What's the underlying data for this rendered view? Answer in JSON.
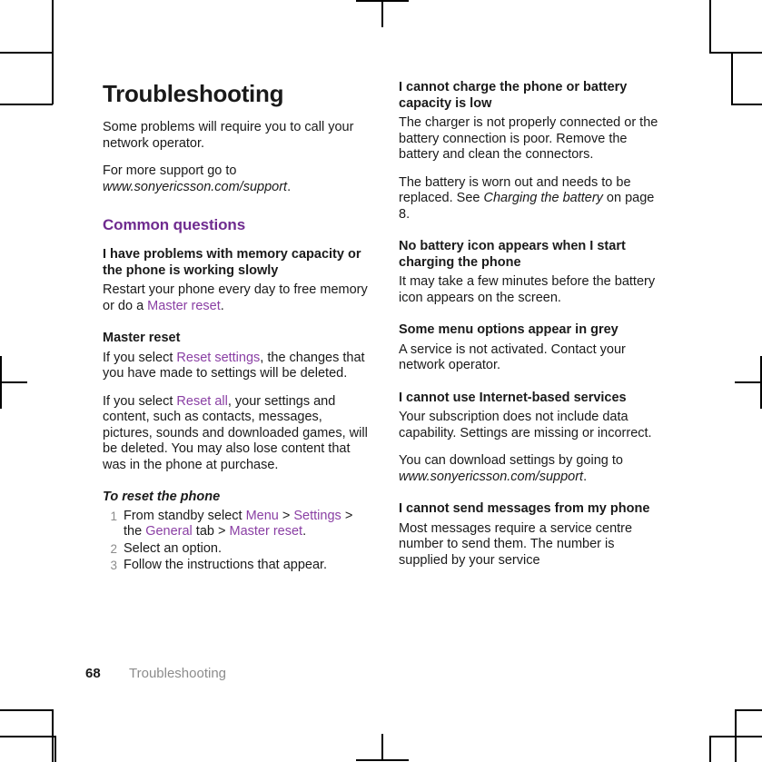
{
  "page": {
    "title": "Troubleshooting",
    "footer": {
      "page_number": "68",
      "label": "Troubleshooting"
    },
    "accent_color": "#6f2b8f",
    "link_color": "#8a3fa4",
    "step_number_color": "#8c8c8c",
    "footer_label_color": "#8c8c8c"
  },
  "left_column": {
    "intro_1": "Some problems will require you to call your network operator.",
    "intro_2_prefix": "For more support go to ",
    "intro_2_url": "www.sonyericsson.com/support",
    "intro_2_suffix": ".",
    "section_heading": "Common questions",
    "q1": {
      "title": "I have problems with memory capacity or the phone is working slowly",
      "body_prefix": "Restart your phone every day to free memory or do a ",
      "body_link": "Master reset",
      "body_suffix": "."
    },
    "master_reset": {
      "title": "Master reset",
      "p1_prefix": "If you select ",
      "p1_link": "Reset settings",
      "p1_suffix": ", the changes that you have made to settings will be deleted.",
      "p2_prefix": "If you select ",
      "p2_link": "Reset all",
      "p2_suffix": ", your settings and content, such as contacts, messages, pictures, sounds and downloaded games, will be deleted. You may also lose content that was in the phone at purchase."
    },
    "procedure": {
      "title": "To reset the phone",
      "steps": [
        {
          "num": "1",
          "prefix": "From standby select ",
          "link1": "Menu",
          "mid1": " > ",
          "link2": "Settings",
          "mid2": " > the ",
          "link3": "General",
          "mid3": " tab > ",
          "link4": "Master reset",
          "suffix": "."
        },
        {
          "num": "2",
          "text": "Select an option."
        },
        {
          "num": "3",
          "text": "Follow the instructions that appear."
        }
      ]
    }
  },
  "right_column": {
    "q2": {
      "title": "I cannot charge the phone or battery capacity is low",
      "p1": "The charger is not properly connected or the battery connection is poor. Remove the battery and clean the connectors.",
      "p2_prefix": "The battery is worn out and needs to be replaced. See ",
      "p2_italic": "Charging the battery",
      "p2_suffix": " on page 8."
    },
    "q3": {
      "title": "No battery icon appears when I start charging the phone",
      "p1": "It may take a few minutes before the battery icon appears on the screen."
    },
    "q4": {
      "title": "Some menu options appear in grey",
      "p1": "A service is not activated. Contact your network operator."
    },
    "q5": {
      "title": "I cannot use Internet-based services",
      "p1": "Your subscription does not include data capability. Settings are missing or incorrect.",
      "p2_prefix": "You can download settings by going to ",
      "p2_url": "www.sonyericsson.com/support",
      "p2_suffix": "."
    },
    "q6": {
      "title": "I cannot send messages from my phone",
      "p1": "Most messages require a service centre number to send them. The number is supplied by your service"
    }
  }
}
